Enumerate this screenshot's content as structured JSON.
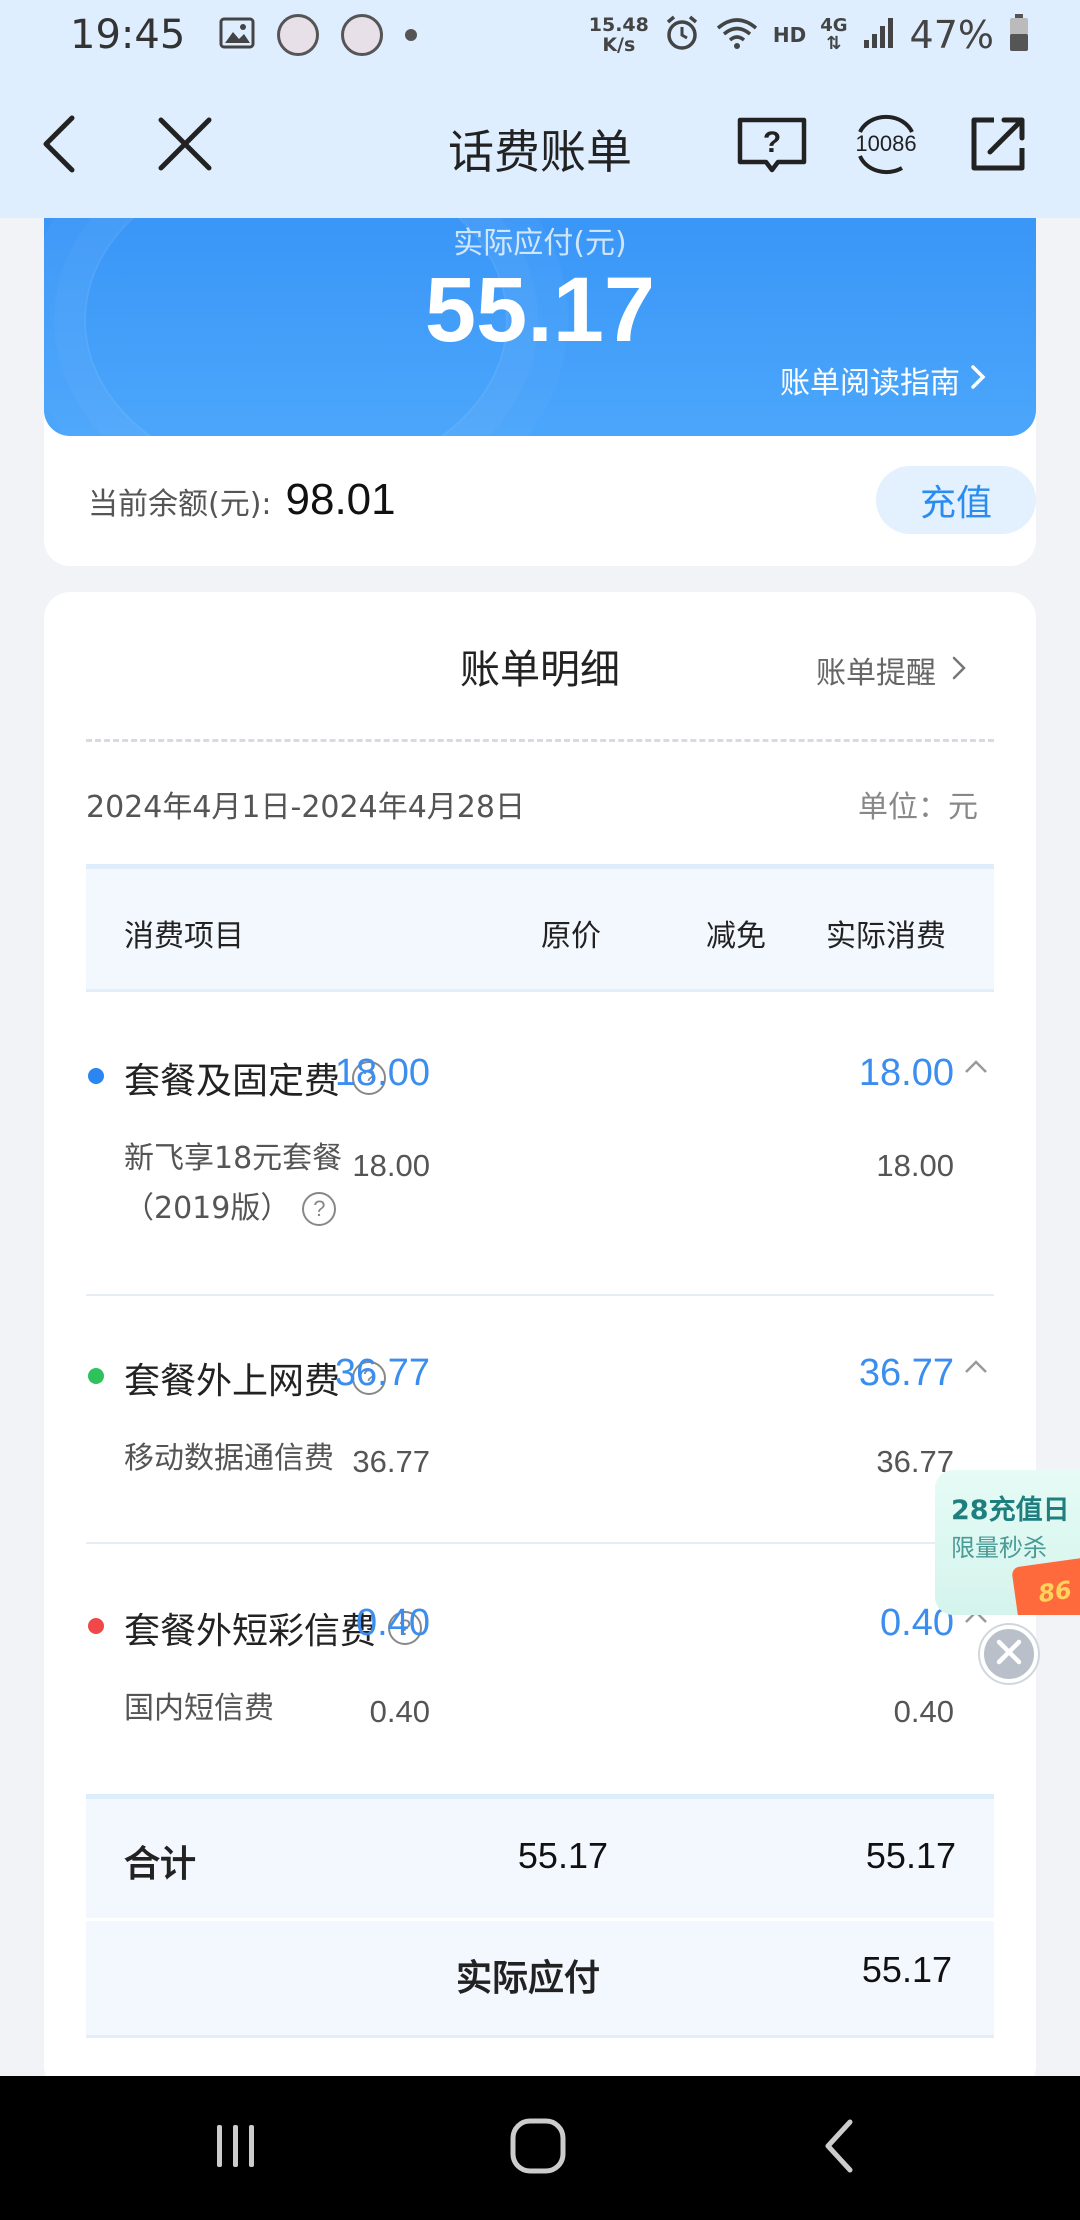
{
  "status_bar": {
    "time": "19:45",
    "net_speed_value": "15.48",
    "net_speed_unit": "K/s",
    "hd_label": "HD",
    "network_type": "4G",
    "battery_percent": "47%",
    "icons": [
      "gallery-icon",
      "avatar-icon",
      "avatar-icon",
      "dot-icon",
      "alarm-icon",
      "wifi-icon",
      "signal-icon",
      "battery-icon"
    ]
  },
  "header": {
    "title": "话费账单",
    "service_number": "10086",
    "icons": [
      "back-icon",
      "close-icon",
      "help-book-icon",
      "customer-service-icon",
      "share-icon"
    ]
  },
  "summary": {
    "payable_label": "实际应付(元)",
    "payable_amount": "55.17",
    "guide_link": "账单阅读指南",
    "balance_label": "当前余额(元):",
    "balance_value": "98.01",
    "recharge_button": "充值"
  },
  "bill": {
    "title": "账单明细",
    "remind_link": "账单提醒",
    "period": "2024年4月1日-2024年4月28日",
    "unit": "单位：元",
    "columns": [
      "消费项目",
      "原价",
      "减免",
      "实际消费"
    ],
    "groups": [
      {
        "name": "套餐及固定费",
        "dot_color": "#2a86f0",
        "original": "18.00",
        "actual": "18.00",
        "items": [
          {
            "name_line1": "新飞享18元套餐",
            "name_line2": "（2019版）",
            "original": "18.00",
            "actual": "18.00"
          }
        ]
      },
      {
        "name": "套餐外上网费",
        "dot_color": "#2fc25b",
        "original": "36.77",
        "actual": "36.77",
        "items": [
          {
            "name_line1": "移动数据通信费",
            "original": "36.77",
            "actual": "36.77"
          }
        ]
      },
      {
        "name": "套餐外短彩信费",
        "dot_color": "#f04848",
        "original": "0.40",
        "actual": "0.40",
        "items": [
          {
            "name_line1": "国内短信费",
            "original": "0.40",
            "actual": "0.40"
          }
        ]
      }
    ],
    "total_label": "合计",
    "total_original": "55.17",
    "total_actual": "55.17",
    "payable_label": "实际应付",
    "payable_value": "55.17"
  },
  "promo": {
    "title": "28充值日",
    "subtitle": "限量秒杀",
    "coupon_text": "86"
  },
  "colors": {
    "accent": "#3b8ef0",
    "header_bg": "#deeeff",
    "card_blue": "#4ba6fb"
  }
}
